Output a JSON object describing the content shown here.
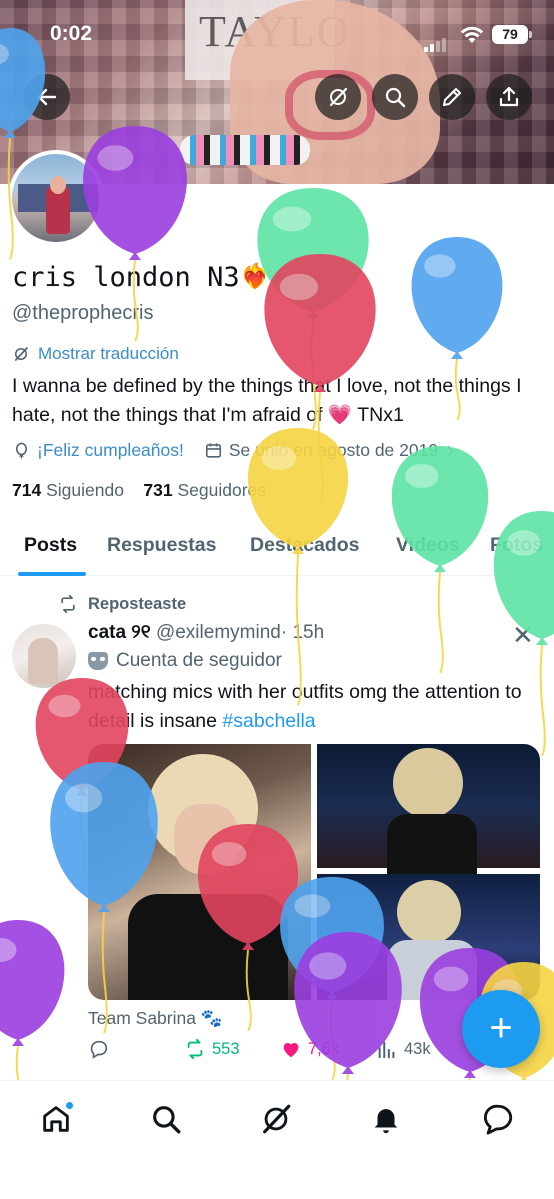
{
  "status_bar": {
    "time": "0:02",
    "battery": "79"
  },
  "banner": {
    "poster_text": "TAYLO"
  },
  "header": {
    "buttons": [
      "back",
      "grok",
      "search",
      "edit",
      "share"
    ]
  },
  "profile": {
    "display_name": "cris london N3",
    "name_emoji": "❤‍🔥",
    "handle": "@theprophecris",
    "translate_label": "Mostrar traducción",
    "bio": "I wanna be defined by the things that I love, not the things I hate, not the things that I'm afraid of 💗 TNx1",
    "birthday": "¡Feliz cumpleaños!",
    "joined": "Se unió en agosto de 2019",
    "following_count": "714",
    "following_label": "Siguiendo",
    "followers_count": "731",
    "followers_label": "Seguidores"
  },
  "tabs": [
    {
      "label": "Posts",
      "active": true
    },
    {
      "label": "Respuestas",
      "active": false
    },
    {
      "label": "Destacados",
      "active": false
    },
    {
      "label": "Videos",
      "active": false
    },
    {
      "label": "Fotos",
      "active": false
    }
  ],
  "post": {
    "repost_label": "Reposteaste",
    "author_name": "cata ୨୧",
    "author_handle": "@exilemymind",
    "time": "· 15h",
    "account_label": "Cuenta de seguidor",
    "text": "matching mics with her outfits omg the attention to detail is insane ",
    "hashtag": "#sabchella",
    "media_caption": "Team Sabrina 🐾",
    "retweets": "553",
    "likes": "7,6k",
    "views": "43k"
  },
  "fab_label": "+",
  "colors": {
    "accent": "#1d9bf0",
    "link": "#3a8ccd",
    "retweet": "#00ba7c",
    "like": "#f91880",
    "balloon_purple": "#9b3fe0",
    "balloon_green": "#5ee4a6",
    "balloon_red": "#e2455f",
    "balloon_blue": "#4fa3ee",
    "balloon_yellow": "#f6d443"
  },
  "bottom_nav": [
    "home",
    "search",
    "grok",
    "notifications",
    "messages"
  ]
}
